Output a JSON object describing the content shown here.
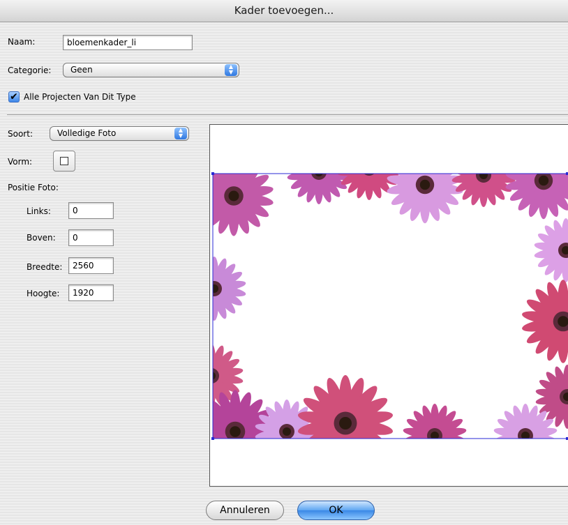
{
  "window": {
    "title": "Kader toevoegen..."
  },
  "form": {
    "name_label": "Naam:",
    "name_value": "bloemenkader_li",
    "category_label": "Categorie:",
    "category_value": "Geen",
    "all_projects_label": "Alle Projecten Van Dit Type",
    "all_projects_checked": true,
    "type_label": "Soort:",
    "type_value": "Volledige Foto",
    "shape_label": "Vorm:",
    "shape_value": "square",
    "photo_position_label": "Positie Foto:",
    "left_label": "Links:",
    "left_value": "0",
    "top_label": "Boven:",
    "top_value": "0",
    "width_label": "Breedte:",
    "width_value": "2560",
    "height_label": "Hoogte:",
    "height_value": "1920"
  },
  "buttons": {
    "cancel_label": "Annuleren",
    "ok_label": "OK"
  },
  "colors": {
    "selection_blue": "#2a2ad4",
    "accent": "#3a88e6"
  },
  "icons": {
    "checkmark": "check-icon",
    "popup_arrows": "updown-arrows-icon"
  }
}
